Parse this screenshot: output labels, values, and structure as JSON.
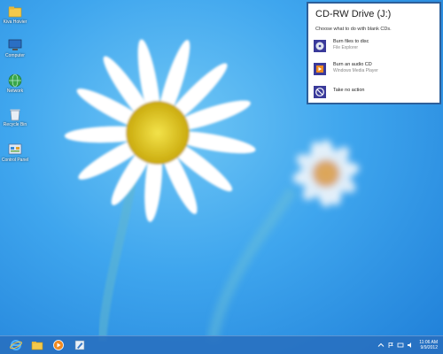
{
  "desktop": {
    "icons": [
      {
        "label": "Kiva Hoivier",
        "icon": "folder-icon"
      },
      {
        "label": "Computer",
        "icon": "computer-icon"
      },
      {
        "label": "Network",
        "icon": "network-icon"
      },
      {
        "label": "Recycle Bin",
        "icon": "recycle-bin-icon"
      },
      {
        "label": "Control Panel",
        "icon": "control-panel-icon"
      }
    ]
  },
  "autoplay": {
    "title": "CD-RW Drive (J:)",
    "subtitle": "Choose what to do with blank CDs.",
    "options": [
      {
        "main": "Burn files to disc",
        "secondary": "File Explorer",
        "icon": "burn-disc-icon"
      },
      {
        "main": "Burn an audio CD",
        "secondary": "Windows Media Player",
        "icon": "media-player-icon"
      },
      {
        "main": "Take no action",
        "secondary": "",
        "icon": "no-action-icon"
      }
    ]
  },
  "taskbar": {
    "buttons": [
      "internet-explorer-icon",
      "file-explorer-icon",
      "media-player-icon",
      "paint-icon"
    ],
    "clock_time": "11:06 AM",
    "clock_date": "9/9/2012"
  },
  "colors": {
    "toast_border": "#2d5f9a",
    "taskbar": "#286ebe",
    "accent": "#3a3a9a"
  }
}
